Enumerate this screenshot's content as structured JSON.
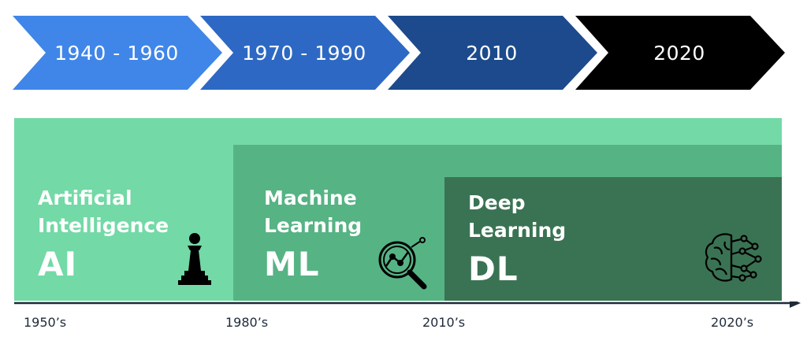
{
  "timeline": {
    "periods": [
      {
        "label": "1940 - 1960",
        "color": "#3f86e8"
      },
      {
        "label": "1970 - 1990",
        "color": "#2d69c4"
      },
      {
        "label": "2010",
        "color": "#1c4a8c"
      },
      {
        "label": "2020",
        "color": "#000000"
      }
    ]
  },
  "fields": {
    "ai": {
      "title_line1": "Artificial",
      "title_line2": "Intelligence",
      "abbr": "AI",
      "color": "#73d9a6",
      "icon": "chess-pawn-icon"
    },
    "ml": {
      "title_line1": "Machine",
      "title_line2": "Learning",
      "abbr": "ML",
      "color": "#56b384",
      "icon": "magnifier-chart-icon"
    },
    "dl": {
      "title_line1": "Deep",
      "title_line2": "Learning",
      "abbr": "DL",
      "color": "#3a7353",
      "icon": "brain-network-icon"
    }
  },
  "axis": {
    "ticks": [
      "1950’s",
      "1980’s",
      "2010’s",
      "2020’s"
    ],
    "color": "#1e2a3a"
  }
}
